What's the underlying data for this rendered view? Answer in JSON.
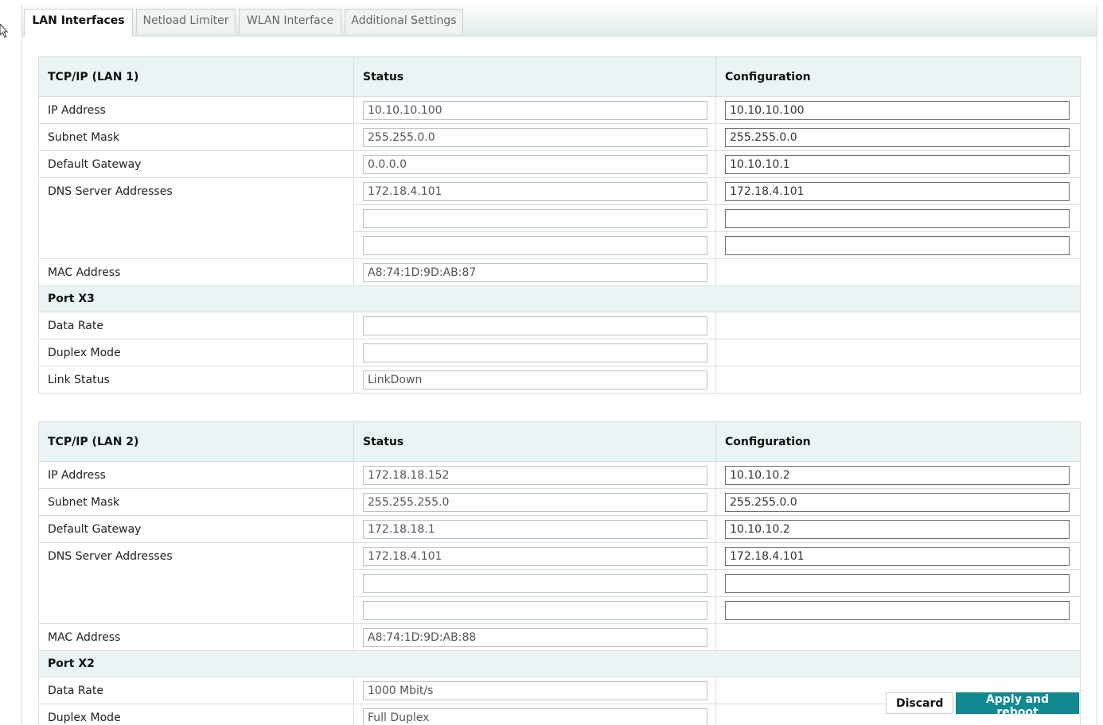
{
  "tabs": [
    {
      "label": "LAN Interfaces",
      "active": true
    },
    {
      "label": "Netload Limiter",
      "active": false
    },
    {
      "label": "WLAN Interface",
      "active": false
    },
    {
      "label": "Additional Settings",
      "active": false
    }
  ],
  "lan1": {
    "title": "TCP/IP (LAN 1)",
    "status_header": "Status",
    "config_header": "Configuration",
    "ip_label": "IP Address",
    "ip_status": "10.10.10.100",
    "ip_config": "10.10.10.100",
    "subnet_label": "Subnet Mask",
    "subnet_status": "255.255.0.0",
    "subnet_config": "255.255.0.0",
    "gateway_label": "Default Gateway",
    "gateway_status": "0.0.0.0",
    "gateway_config": "10.10.10.1",
    "dns_label": "DNS Server Addresses",
    "dns_status": [
      "172.18.4.101",
      "",
      ""
    ],
    "dns_config": [
      "172.18.4.101",
      "",
      ""
    ],
    "mac_label": "MAC Address",
    "mac_status": "A8:74:1D:9D:AB:87",
    "port_title": "Port X3",
    "rate_label": "Data Rate",
    "rate_status": "",
    "duplex_label": "Duplex Mode",
    "duplex_status": "",
    "link_label": "Link Status",
    "link_status": "LinkDown"
  },
  "lan2": {
    "title": "TCP/IP (LAN 2)",
    "status_header": "Status",
    "config_header": "Configuration",
    "ip_label": "IP Address",
    "ip_status": "172.18.18.152",
    "ip_config": "10.10.10.2",
    "subnet_label": "Subnet Mask",
    "subnet_status": "255.255.255.0",
    "subnet_config": "255.255.0.0",
    "gateway_label": "Default Gateway",
    "gateway_status": "172.18.18.1",
    "gateway_config": "10.10.10.2",
    "dns_label": "DNS Server Addresses",
    "dns_status": [
      "172.18.4.101",
      "",
      ""
    ],
    "dns_config": [
      "172.18.4.101",
      "",
      ""
    ],
    "mac_label": "MAC Address",
    "mac_status": "A8:74:1D:9D:AB:88",
    "port_title": "Port X2",
    "rate_label": "Data Rate",
    "rate_status": "1000 Mbit/s",
    "duplex_label": "Duplex Mode",
    "duplex_status": "Full Duplex"
  },
  "actions": {
    "discard_label": "Discard",
    "apply_label": "Apply and reboot"
  },
  "colors": {
    "accent": "#128a92",
    "header_bg": "#eaf4f4"
  }
}
